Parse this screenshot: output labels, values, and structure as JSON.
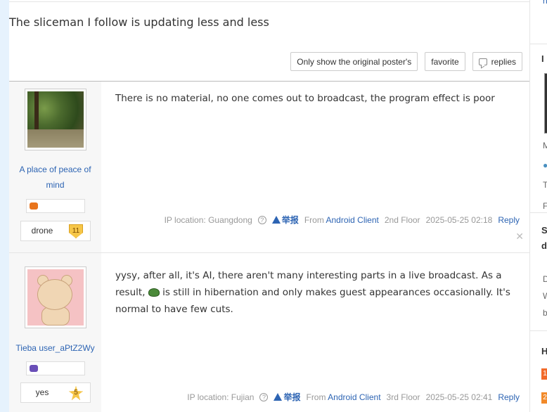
{
  "thread": {
    "title": "The sliceman I follow is updating less and less"
  },
  "toolbar": {
    "only_op_label": "Only show the original poster's",
    "favorite_label": "favorite",
    "replies_label": "replies"
  },
  "posts": [
    {
      "author": "A place of peace of mind",
      "level_name": "drone",
      "level_num": "11",
      "content": "There is no material, no one comes out to broadcast, the program effect is poor",
      "ip_location": "IP location: Guangdong",
      "report_label": "举报",
      "from_label": "From",
      "client": "Android Client",
      "floor": "2nd Floor",
      "datetime": "2025-05-25 02:18",
      "reply_label": "Reply"
    },
    {
      "author": "Tieba user_aPtZ2Wy",
      "level_name": "yes",
      "level_num": "5",
      "content_part1": "yysy, after all, it's AI, there aren't many interesting parts in a live broadcast. As a result,",
      "content_part2": "is still in hibernation and only makes guest appearances occasionally. It's normal to have few cuts.",
      "ip_location": "IP location: Fujian",
      "report_label": "举报",
      "from_label": "From",
      "client": "Android Client",
      "floor": "3rd Floor",
      "datetime": "2025-05-25 02:41",
      "reply_label": "Reply"
    }
  ],
  "right_column": {
    "top_link": "h",
    "heading1": "I",
    "small1": "M",
    "small2": "T",
    "small3": "F",
    "heading2a": "S",
    "heading2b": "d",
    "small4": "D",
    "small5": "W",
    "small6": "b",
    "heading3": "H",
    "rank1": "1",
    "rank2": "2"
  },
  "colors": {
    "link": "#2d64b3",
    "author_bg": "#f7f7f7",
    "left_strip": "#e6f2fd",
    "level_badge": "#f6c648",
    "rank1": "#f26a2a",
    "rank2": "#f28a2a"
  }
}
